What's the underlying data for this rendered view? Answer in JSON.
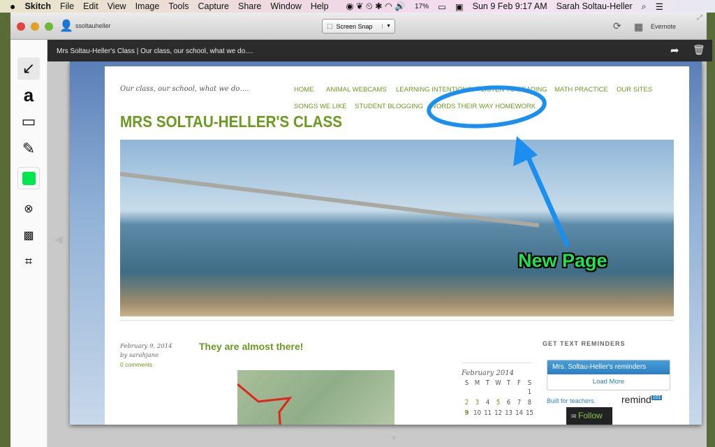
{
  "menubar": {
    "app": "Skitch",
    "items": [
      "File",
      "Edit",
      "View",
      "Image",
      "Tools",
      "Capture",
      "Share",
      "Window",
      "Help"
    ],
    "battery": "17%",
    "datetime": "Sun 9 Feb  9:17 AM",
    "user": "Sarah Soltau-Heller"
  },
  "titlebar": {
    "username": "ssoltauheller",
    "snap_label": "Screen Snap",
    "evernote_label": "Evernote"
  },
  "darkbar": {
    "title": "Mrs Soltau-Heller's Class | Our class, our school, what we do...."
  },
  "toolbar": {
    "color": "#00e64d"
  },
  "site": {
    "tagline": "Our class, our school, what we do….",
    "nav": [
      "HOME",
      "ANIMAL WEBCAMS",
      "LEARNING INTENTIONS",
      "LISTEN TO READING",
      "MATH PRACTICE",
      "OUR SITES",
      "SONGS WE LIKE",
      "STUDENT BLOGGING",
      "WORDS THEIR WAY HOMEWORK"
    ],
    "title": "MRS SOLTAU-HELLER'S CLASS",
    "post": {
      "date": "February 9, 2014",
      "author": "by sarahjane",
      "comments": "0 comments",
      "title": "They are almost there!"
    },
    "calendar": {
      "caption": "February 2014",
      "days": [
        "S",
        "M",
        "T",
        "W",
        "T",
        "F",
        "S"
      ],
      "rows": [
        [
          "",
          "",
          "",
          "",
          "",
          "",
          "1"
        ],
        [
          "2",
          "3",
          "4",
          "5",
          "6",
          "7",
          "8"
        ],
        [
          "9",
          "10",
          "11",
          "12",
          "13",
          "14",
          "15"
        ]
      ]
    },
    "widget": {
      "heading": "GET TEXT REMINDERS",
      "box_title": "Mrs. Soltau-Heller's reminders",
      "load_more": "Load More",
      "built": "Built for teachers.",
      "brand": "remind",
      "brand_badge": "101",
      "follow": "Follow"
    }
  },
  "annotation": {
    "text": "New Page",
    "color": "#1a8ff0"
  }
}
